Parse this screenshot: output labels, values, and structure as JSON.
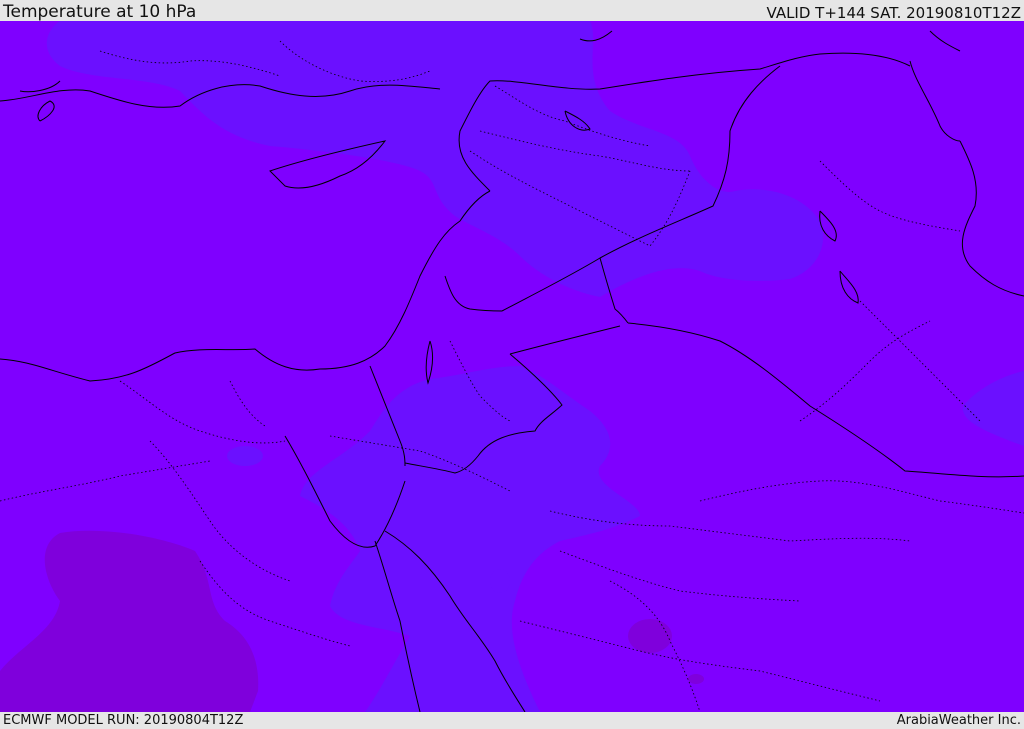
{
  "header": {
    "title": "Temperature at 10 hPa",
    "valid": "VALID T+144 SAT. 20190810T12Z"
  },
  "footer": {
    "model_run": "ECMWF MODEL RUN: 20190804T12Z",
    "credit": "ArabiaWeather Inc."
  },
  "colors": {
    "base_field": "#7f00ff",
    "cool_band": "#6b10ff",
    "warm_patch": "#7f00dc",
    "coastline": "#000000",
    "border": "#000000"
  }
}
